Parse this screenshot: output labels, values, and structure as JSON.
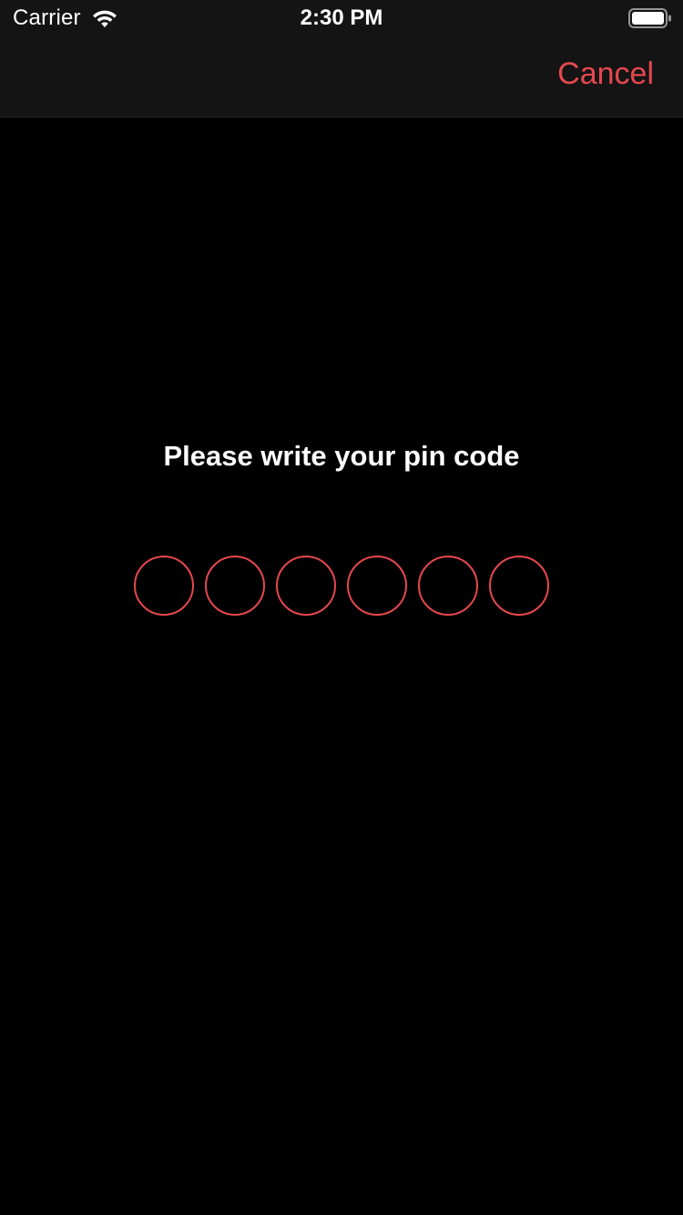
{
  "status_bar": {
    "carrier": "Carrier",
    "time": "2:30 PM",
    "wifi_icon": "wifi-icon",
    "battery_icon": "battery-icon"
  },
  "nav": {
    "cancel_label": "Cancel"
  },
  "pin_entry": {
    "prompt": "Please write your pin code",
    "digits_total": 6,
    "digits_entered": 0
  },
  "colors": {
    "accent": "#e5484d",
    "background": "#000000",
    "bar": "#141414",
    "text": "#ffffff"
  }
}
